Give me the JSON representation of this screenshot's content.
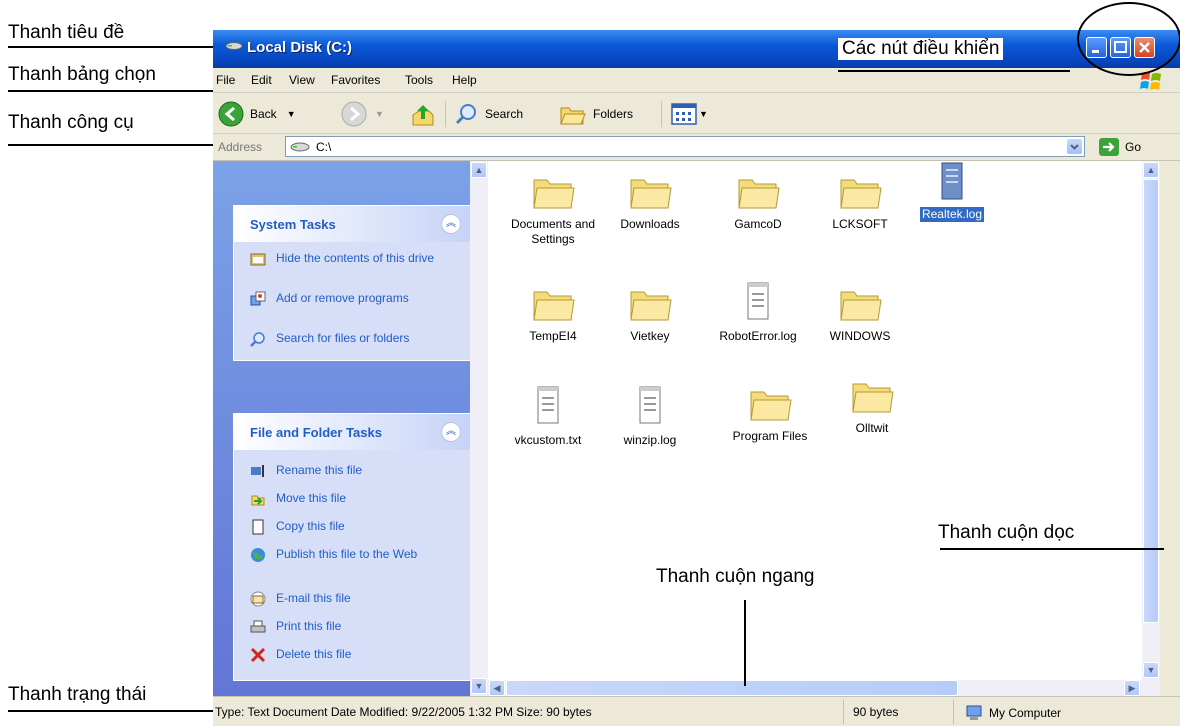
{
  "annotations": {
    "title_bar": "Thanh tiêu đề",
    "menu_bar": "Thanh bảng chọn",
    "toolbar": "Thanh công cụ",
    "status_bar": "Thanh trạng thái",
    "control_buttons": "Các nút điều khiển",
    "vertical_scrollbar": "Thanh cuộn dọc",
    "horizontal_scrollbar": "Thanh cuộn ngang"
  },
  "window": {
    "title": "Local Disk (C:)",
    "menu": [
      "File",
      "Edit",
      "View",
      "Favorites",
      "Tools",
      "Help"
    ],
    "toolbar": {
      "back": "Back",
      "search": "Search",
      "folders": "Folders"
    },
    "address": {
      "label": "Address",
      "value": "C:\\",
      "go": "Go"
    }
  },
  "system_tasks": {
    "title": "System Tasks",
    "items": [
      {
        "label": "Hide the contents of this drive",
        "icon": "hide-drive-icon"
      },
      {
        "label": "Add or remove programs",
        "icon": "add-remove-icon"
      },
      {
        "label": "Search for files or folders",
        "icon": "search-icon"
      }
    ]
  },
  "file_tasks": {
    "title": "File and Folder Tasks",
    "items": [
      {
        "label": "Rename this file",
        "icon": "rename-icon"
      },
      {
        "label": "Move this file",
        "icon": "move-icon"
      },
      {
        "label": "Copy this file",
        "icon": "copy-icon"
      },
      {
        "label": "Publish this file to the Web",
        "icon": "publish-icon"
      },
      {
        "label": "E-mail this file",
        "icon": "email-icon"
      },
      {
        "label": "Print this file",
        "icon": "print-icon"
      },
      {
        "label": "Delete this file",
        "icon": "delete-icon"
      }
    ]
  },
  "files": [
    {
      "name": "Documents and Settings",
      "type": "folder"
    },
    {
      "name": "Downloads",
      "type": "folder"
    },
    {
      "name": "GamcoD",
      "type": "folder"
    },
    {
      "name": "LCKSOFT",
      "type": "folder"
    },
    {
      "name": "Realtek.log",
      "type": "log",
      "selected": true
    },
    {
      "name": "TempEI4",
      "type": "folder"
    },
    {
      "name": "Vietkey",
      "type": "folder"
    },
    {
      "name": "RobotError.log",
      "type": "text"
    },
    {
      "name": "WINDOWS",
      "type": "folder"
    },
    {
      "name": "vkcustom.txt",
      "type": "text"
    },
    {
      "name": "winzip.log",
      "type": "text"
    },
    {
      "name": "Program Files",
      "type": "folder"
    },
    {
      "name": "Olltwit",
      "type": "folder"
    }
  ],
  "status": {
    "info": "Type: Text Document Date Modified: 9/22/2005 1:32 PM Size: 90 bytes",
    "size": "90 bytes",
    "location": "My Computer"
  }
}
